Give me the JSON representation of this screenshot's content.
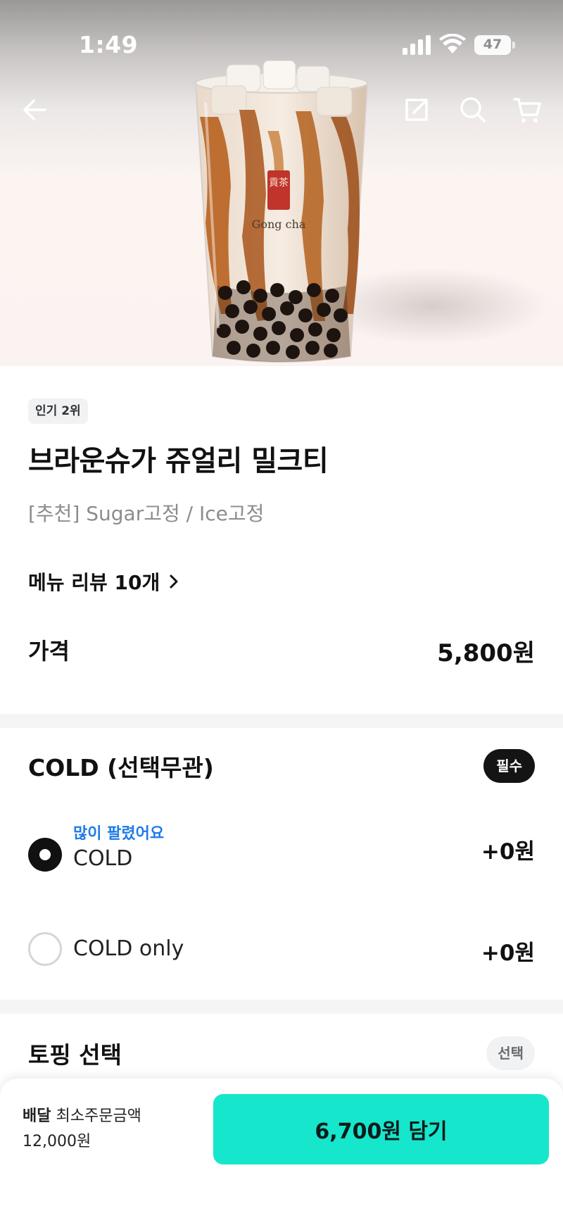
{
  "status_bar": {
    "time": "1:49",
    "battery": "47",
    "icons": [
      "cellular-signal-icon",
      "wifi-icon",
      "battery-icon"
    ]
  },
  "top_nav": {
    "back_icon": "arrow-left-icon",
    "share_icon": "share-icon",
    "search_icon": "search-icon",
    "cart_icon": "cart-icon"
  },
  "hero": {
    "logo_text": "Gong cha",
    "logo_characters": "貢茶"
  },
  "product": {
    "rank_badge": "인기 2위",
    "title": "브라운슈가 쥬얼리 밀크티",
    "description": "[추천] Sugar고정 / Ice고정",
    "review_link": "메뉴 리뷰 10개",
    "price_label": "가격",
    "price": "5,800원"
  },
  "temperature_options": {
    "title": "COLD (선택무관)",
    "badge": "필수",
    "options": [
      {
        "hint": "많이 팔렸어요",
        "name": "COLD",
        "price": "+0원",
        "selected": true
      },
      {
        "hint": "",
        "name": "COLD only",
        "price": "+0원",
        "selected": false
      }
    ]
  },
  "topping": {
    "title": "토핑 선택",
    "badge": "선택"
  },
  "bottom_bar": {
    "delivery_label": "배달",
    "min_order_label": "최소주문금액",
    "min_order_amount": "12,000원",
    "cart_button": "6,700원 담기"
  },
  "colors": {
    "accent_mint": "#16e6cc",
    "hint_blue": "#1f7be8",
    "badge_dark": "#141414",
    "divider_gray": "#f4f5f6"
  }
}
